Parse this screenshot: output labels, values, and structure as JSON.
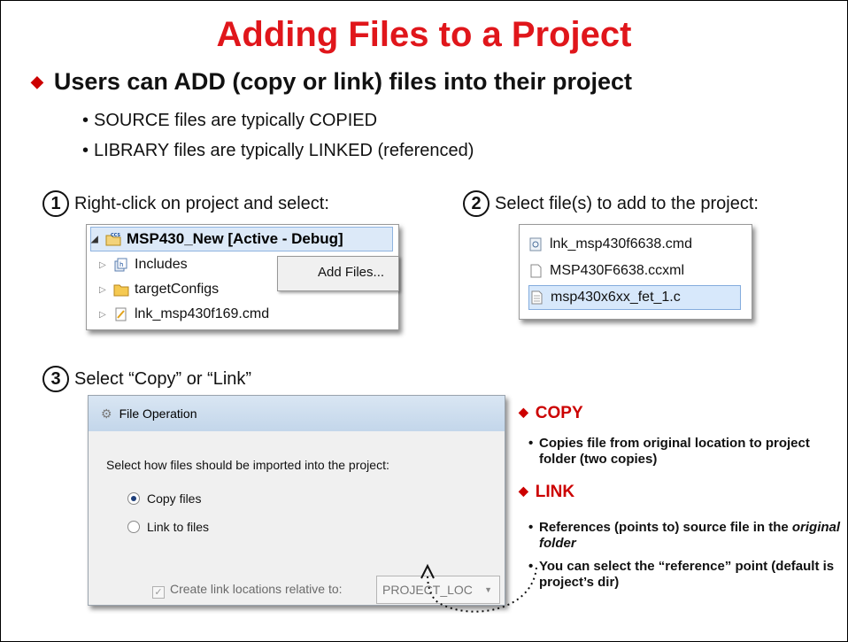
{
  "title": "Adding Files to a Project",
  "main_bullet": "Users can ADD (copy or link) files into their project",
  "sub_bullets": [
    "SOURCE files are typically COPIED",
    "LIBRARY files are typically LINKED (referenced)"
  ],
  "steps": [
    {
      "num": "1",
      "text": "Right-click on project and select:"
    },
    {
      "num": "2",
      "text": "Select file(s) to add to the project:"
    },
    {
      "num": "3",
      "text": "Select “Copy” or “Link”"
    }
  ],
  "project_tree": {
    "project": "MSP430_New  [Active - Debug]",
    "items": [
      "Includes",
      "targetConfigs",
      "lnk_msp430f169.cmd"
    ],
    "context_menu_item": "Add Files..."
  },
  "file_list": [
    "lnk_msp430f6638.cmd",
    "MSP430F6638.ccxml",
    "msp430x6xx_fet_1.c"
  ],
  "file_operation": {
    "title": "File Operation",
    "prompt": "Select how files should be imported into the project:",
    "copy_label": "Copy files",
    "link_label": "Link to files",
    "create_link_label": "Create link locations relative to:",
    "combo_value": "PROJECT_LOC"
  },
  "copy": {
    "heading": "COPY",
    "bullet": "Copies file from original location to project folder (two copies)"
  },
  "link": {
    "heading": "LINK",
    "bullet1_a": "References (points to) source file in the ",
    "bullet1_b": "original folder",
    "bullet2": "You can select the “reference” point (default is project’s dir)"
  },
  "colors": {
    "title": "#e0161b",
    "accent": "#cc0000",
    "selection": "#d7e8fb"
  }
}
